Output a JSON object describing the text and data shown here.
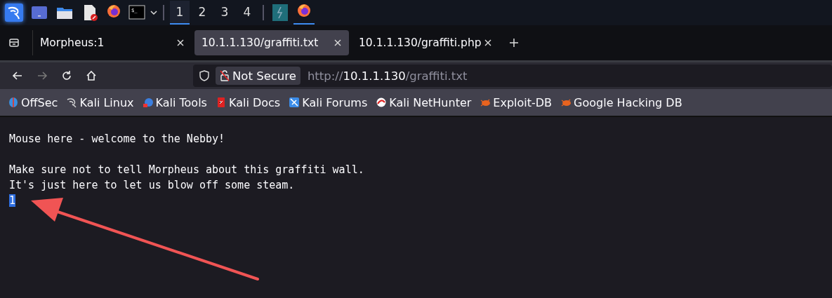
{
  "taskbar": {
    "apps": [
      {
        "kind": "kali",
        "active": true
      },
      {
        "kind": "desktop",
        "active": false
      },
      {
        "kind": "files",
        "active": false
      },
      {
        "kind": "editor",
        "active": false
      },
      {
        "kind": "firefox",
        "active": false
      },
      {
        "kind": "terminal",
        "active": false,
        "icon_text": "$_"
      }
    ],
    "workspaces": [
      {
        "label": "1",
        "selected": true
      },
      {
        "label": "2",
        "selected": false
      },
      {
        "label": "3",
        "selected": false
      },
      {
        "label": "4",
        "selected": false
      }
    ],
    "windows": [
      {
        "kind": "zap",
        "active": false
      },
      {
        "kind": "firefox",
        "active": true
      }
    ]
  },
  "tabs": [
    {
      "label": "Morpheus:1",
      "selected": false
    },
    {
      "label": "10.1.1.130/graffiti.txt",
      "selected": true
    },
    {
      "label": "10.1.1.130/graffiti.php",
      "selected": false
    }
  ],
  "address_bar": {
    "security": "Not Secure",
    "url_prefix": "http://",
    "url_host": "10.1.1.130",
    "url_path": "/graffiti.txt"
  },
  "bookmarks": [
    {
      "label": "OffSec",
      "kind": "offsec"
    },
    {
      "label": "Kali Linux",
      "kind": "dragon"
    },
    {
      "label": "Kali Tools",
      "kind": "tools"
    },
    {
      "label": "Kali Docs",
      "kind": "docs"
    },
    {
      "label": "Kali Forums",
      "kind": "forums"
    },
    {
      "label": "Kali NetHunter",
      "kind": "nethunter"
    },
    {
      "label": "Exploit-DB",
      "kind": "bug"
    },
    {
      "label": "Google Hacking DB",
      "kind": "bug"
    }
  ],
  "page": {
    "blocks": [
      {
        "lines": [
          {
            "text": "Mouse here - welcome to the Nebby!",
            "selected": false
          }
        ]
      },
      {
        "lines": [
          {
            "text": "Make sure not to tell Morpheus about this graffiti wall.",
            "selected": false
          },
          {
            "text": "It's just here to let us blow off some steam.",
            "selected": false
          },
          {
            "text": "1",
            "selected": true
          }
        ]
      }
    ]
  }
}
